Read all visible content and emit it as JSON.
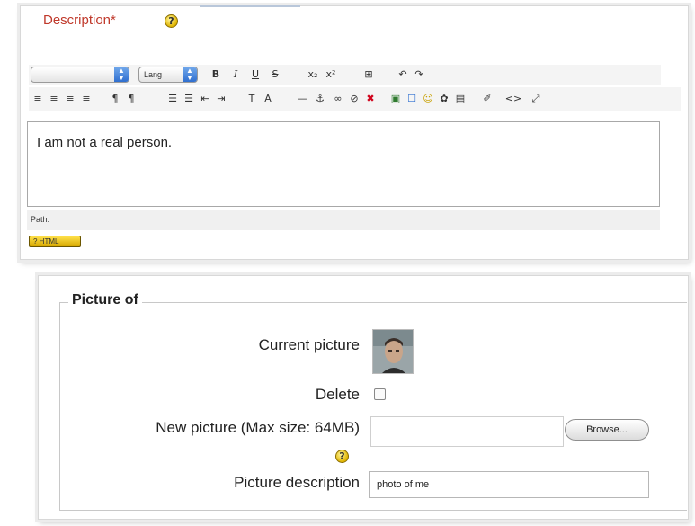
{
  "editor": {
    "label": "Description",
    "required_marker": "*",
    "help_glyph": "?",
    "font_select_value": "",
    "lang_select_value": "Lang",
    "toolbar_row1": [
      "B",
      "I",
      "U",
      "S",
      "x₂",
      "x²",
      "⊞",
      "↶",
      "↷"
    ],
    "toolbar_row2": [
      "≡",
      "≡",
      "≡",
      "≡",
      "¶",
      "¶",
      "☰",
      "☰",
      "⇤",
      "⇥",
      "T",
      "A",
      "—",
      "⚓",
      "∞",
      "⊘",
      "✖",
      "▣",
      "☐",
      "☺",
      "✿",
      "▤",
      "✐",
      "<>",
      "⤢"
    ],
    "content": "I am not a real person.",
    "path_label": "Path:",
    "help_button_label": "? HTML"
  },
  "picture": {
    "legend": "Picture of",
    "current_picture_label": "Current picture",
    "delete_label": "Delete",
    "new_picture_label": "New picture (Max size: 64MB)",
    "browse_label": "Browse...",
    "picture_description_label": "Picture description",
    "picture_description_value": "photo of me",
    "help_glyph": "?"
  },
  "colors": {
    "required_label": "#c0392b",
    "help_icon": "#e0b400",
    "select_arrow": "#2f6fd0"
  }
}
